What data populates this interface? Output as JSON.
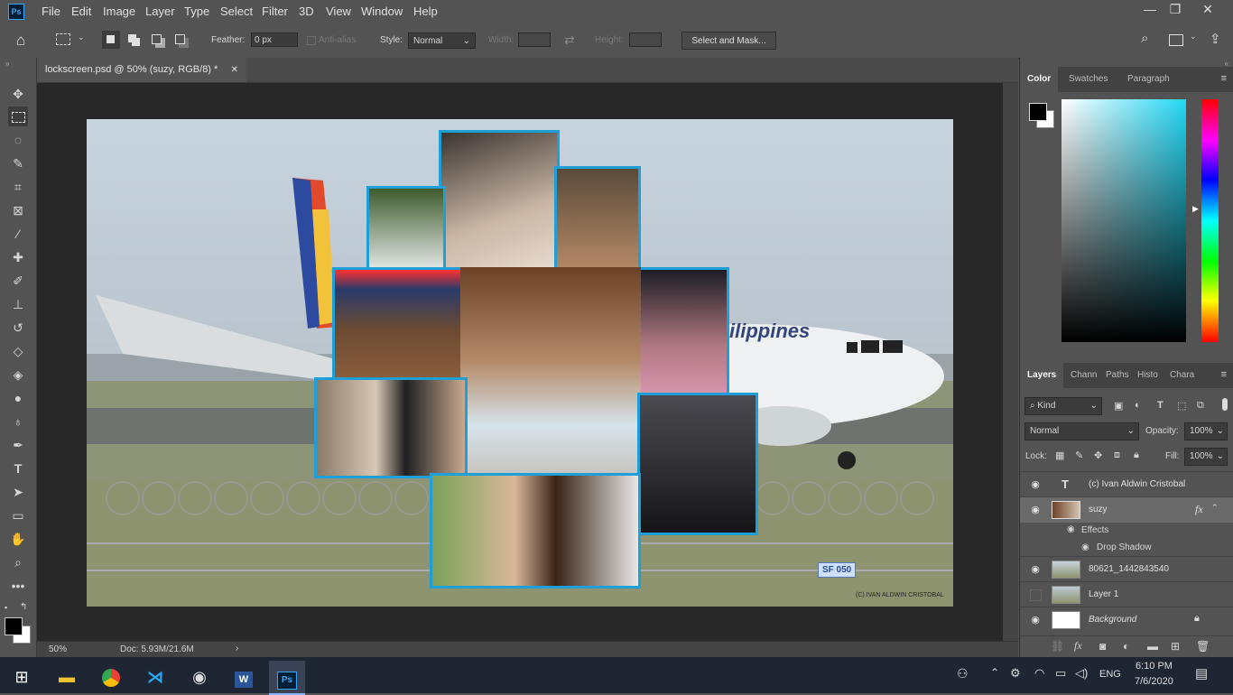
{
  "app": {
    "logo": "Ps"
  },
  "menu": [
    "File",
    "Edit",
    "Image",
    "Layer",
    "Type",
    "Select",
    "Filter",
    "3D",
    "View",
    "Window",
    "Help"
  ],
  "window_controls": {
    "minimize": "—",
    "restore": "❐",
    "close": "✕"
  },
  "options": {
    "feather_label": "Feather:",
    "feather_value": "0 px",
    "antialias_label": "Anti-alias",
    "style_label": "Style:",
    "style_value": "Normal",
    "width_label": "Width:",
    "height_label": "Height:",
    "select_mask_button": "Select and Mask..."
  },
  "document": {
    "tab_title": "lockscreen.psd @ 50% (suzy, RGB/8) *",
    "zoom": "50%",
    "doc_info": "Doc: 5.93M/21.6M",
    "watermark_credit": "(C) IVAN ALDWIN CRISTOBAL",
    "plane_text": "ilippines",
    "sign_text": "SF 050"
  },
  "color_panel": {
    "tabs": [
      "Color",
      "Swatches",
      "Paragraph"
    ],
    "accent": "#23d8f5"
  },
  "layers_panel": {
    "tabs": [
      "Layers",
      "Chann",
      "Paths",
      "Histo",
      "Chara"
    ],
    "kind_label": "Kind",
    "blend_mode": "Normal",
    "opacity_label": "Opacity:",
    "opacity_value": "100%",
    "lock_label": "Lock:",
    "fill_label": "Fill:",
    "fill_value": "100%",
    "layers": [
      {
        "name": "(c) Ivan Aldwin Cristobal",
        "type": "text",
        "visible": true
      },
      {
        "name": "suzy",
        "type": "image",
        "visible": true,
        "selected": true,
        "fx": "fx"
      },
      {
        "name": "Effects",
        "type": "effects",
        "visible": true
      },
      {
        "name": "Drop Shadow",
        "type": "effect",
        "visible": true
      },
      {
        "name": "80621_1442843540",
        "type": "image",
        "visible": true
      },
      {
        "name": "Layer 1",
        "type": "image",
        "visible": false
      },
      {
        "name": "Background",
        "type": "background",
        "visible": true,
        "locked": true
      }
    ]
  },
  "taskbar": {
    "language": "ENG",
    "time": "6:10 PM",
    "date": "7/6/2020"
  }
}
